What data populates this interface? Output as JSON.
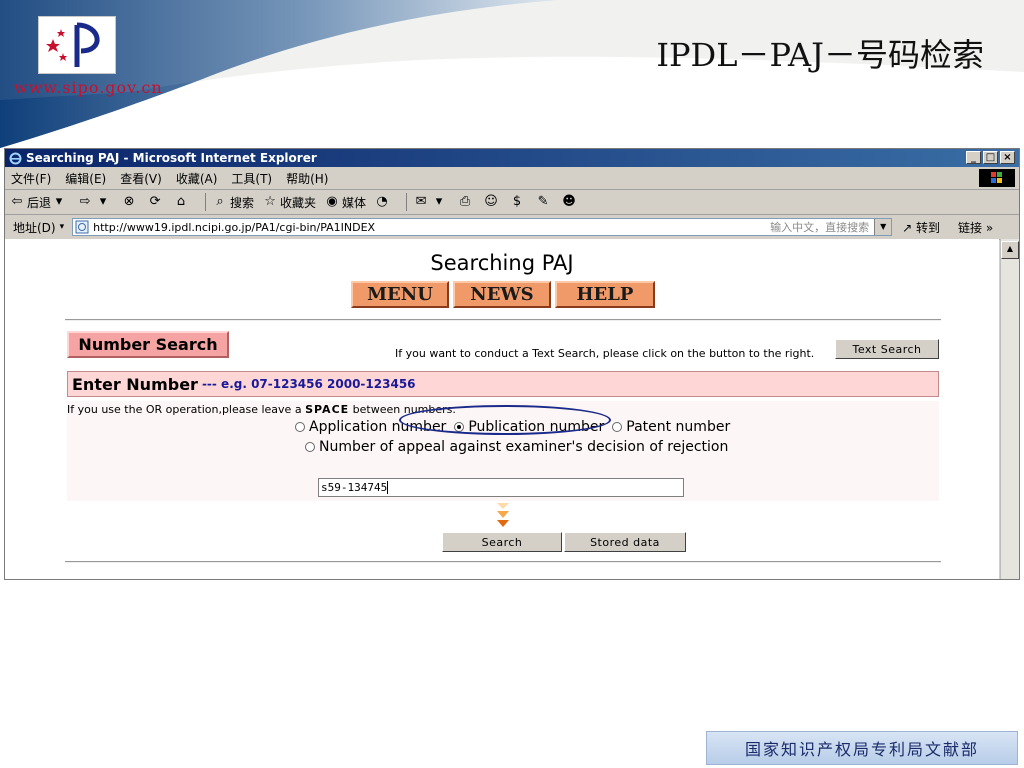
{
  "slide": {
    "title": "IPDL－PAJ－号码检索",
    "site_url": "www.sipo.gov.cn",
    "footer": "国家知识产权局专利局文献部"
  },
  "colors": {
    "title_bar": "#0a246a",
    "nav_button": "#f09a6a",
    "number_search_label": "#f6a3a3",
    "enter_number_bar": "#ffd6d6",
    "example_text": "#1a1a99",
    "highlight_oval": "#1a2a8a"
  },
  "browser": {
    "window_title": "Searching PAJ - Microsoft Internet Explorer",
    "window_controls": [
      "_",
      "□",
      "×"
    ],
    "menu": [
      "文件(F)",
      "编辑(E)",
      "查看(V)",
      "收藏(A)",
      "工具(T)",
      "帮助(H)"
    ],
    "toolbar": {
      "back": "后退",
      "search": "搜索",
      "favorites": "收藏夹",
      "media": "媒体"
    },
    "address": {
      "label": "地址(D)",
      "url": "http://www19.ipdl.ncipi.go.jp/PA1/cgi-bin/PA1INDEX",
      "search_hint": "输入中文，直接搜索",
      "go": "转到",
      "links": "链接"
    }
  },
  "page": {
    "title": "Searching PAJ",
    "nav": [
      "MENU",
      "NEWS",
      "HELP"
    ],
    "number_search_label": "Number Search",
    "text_search_hint": "If you want to conduct a Text Search, please click on the button to the right.",
    "text_search_button": "Text Search",
    "enter_number_title": "Enter Number",
    "enter_number_example": "--- e.g. 07-123456 2000-123456",
    "or_hint_pre": "If you use the OR operation,please leave a",
    "or_hint_space": "SPACE",
    "or_hint_post": "between numbers.",
    "radio_options": [
      {
        "label": "Application number",
        "selected": false
      },
      {
        "label": "Publication number",
        "selected": true
      },
      {
        "label": "Patent number",
        "selected": false
      },
      {
        "label": "Number of appeal against examiner's decision of rejection",
        "selected": false
      }
    ],
    "number_input_value": "s59-134745",
    "search_button": "Search",
    "stored_data_button": "Stored data"
  }
}
